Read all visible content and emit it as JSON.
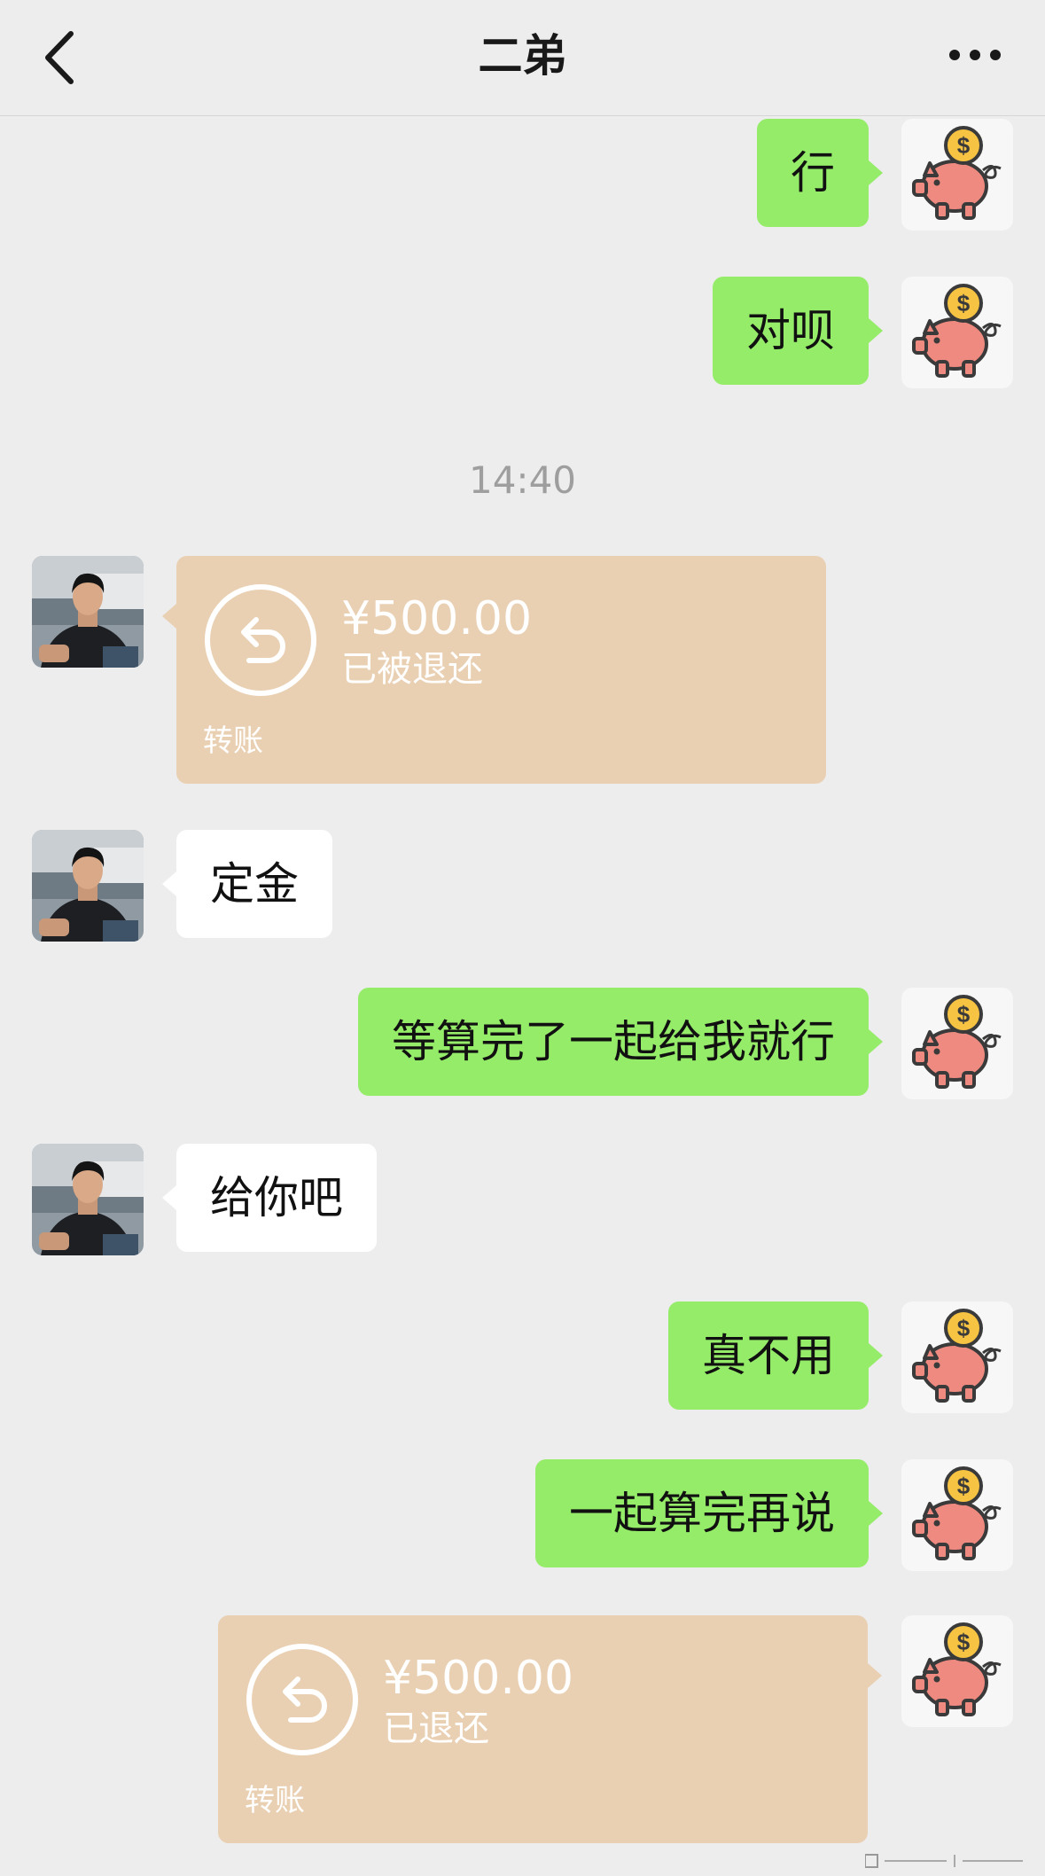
{
  "header": {
    "title": "二弟",
    "back_icon": "chevron-left-icon",
    "more_icon": "more-dots-icon"
  },
  "colors": {
    "background": "#ededed",
    "my_bubble": "#95ec69",
    "their_bubble": "#ffffff",
    "transfer_card": "#ead0b3",
    "pig": "#ef8a80",
    "coin": "#f6c343"
  },
  "timestamp": "14:40",
  "messages": [
    {
      "sender": "me",
      "type": "text",
      "text": "行",
      "avatar_icon": "piggy-bank-icon"
    },
    {
      "sender": "me",
      "type": "text",
      "text": "对呗",
      "avatar_icon": "piggy-bank-icon"
    },
    {
      "sender": "other",
      "type": "transfer",
      "amount": "¥500.00",
      "status": "已被退还",
      "label": "转账",
      "icon": "return-arrow-icon"
    },
    {
      "sender": "other",
      "type": "text",
      "text": "定金"
    },
    {
      "sender": "me",
      "type": "text",
      "text": "等算完了一起给我就行",
      "avatar_icon": "piggy-bank-icon"
    },
    {
      "sender": "other",
      "type": "text",
      "text": "给你吧"
    },
    {
      "sender": "me",
      "type": "text",
      "text": "真不用",
      "avatar_icon": "piggy-bank-icon"
    },
    {
      "sender": "me",
      "type": "text",
      "text": "一起算完再说",
      "avatar_icon": "piggy-bank-icon"
    },
    {
      "sender": "me",
      "type": "transfer",
      "amount": "¥500.00",
      "status": "已退还",
      "label": "转账",
      "icon": "return-arrow-icon"
    }
  ]
}
